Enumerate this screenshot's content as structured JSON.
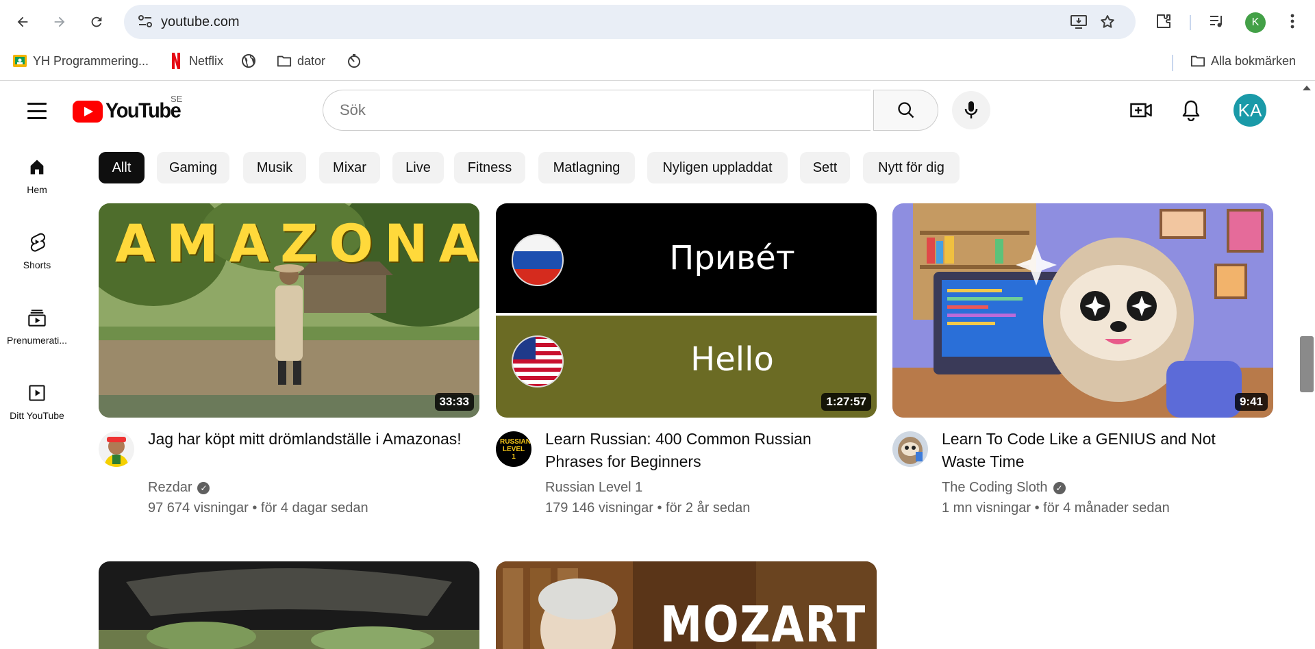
{
  "browser": {
    "url": "youtube.com",
    "bookmarks": [
      {
        "label": "YH Programmering...",
        "icon": "classroom-icon"
      },
      {
        "label": "Netflix",
        "icon": "netflix-icon"
      },
      {
        "label": "",
        "icon": "globe-icon"
      },
      {
        "label": "dator",
        "icon": "folder-icon"
      },
      {
        "label": "",
        "icon": "timer-icon"
      }
    ],
    "all_bookmarks_label": "Alla bokmärken",
    "profile_initial": "K"
  },
  "youtube": {
    "logo_text": "YouTube",
    "country_code": "SE",
    "search_placeholder": "Sök",
    "avatar_initials": "KA",
    "sidebar": [
      {
        "label": "Hem",
        "icon": "home-icon"
      },
      {
        "label": "Shorts",
        "icon": "shorts-icon"
      },
      {
        "label": "Prenumerati...",
        "icon": "subscriptions-icon"
      },
      {
        "label": "Ditt YouTube",
        "icon": "your-youtube-icon"
      }
    ],
    "chips": [
      "Allt",
      "Gaming",
      "Musik",
      "Mixar",
      "Live",
      "Fitness",
      "Matlagning",
      "Nyligen uppladdat",
      "Sett",
      "Nytt för dig"
    ],
    "active_chip": "Allt",
    "videos": [
      {
        "title": "Jag har köpt mitt drömlandställe i Amazonas!",
        "channel": "Rezdar",
        "verified": true,
        "meta": "97 674 visningar • för 4 dagar sedan",
        "duration": "33:33",
        "thumb_text": "AMAZONAS"
      },
      {
        "title": "Learn Russian: 400 Common Russian Phrases for Beginners",
        "channel": "Russian Level 1",
        "verified": false,
        "meta": "179 146 visningar • för 2 år sedan",
        "duration": "1:27:57",
        "thumb_text_top": "Приве́т",
        "thumb_text_bottom": "Hello",
        "avatar_text": "RUSSIAN LEVEL 1"
      },
      {
        "title": "Learn To Code Like a GENIUS and Not Waste Time",
        "channel": "The Coding Sloth",
        "verified": true,
        "meta": "1 mn visningar • för 4 månader sedan",
        "duration": "9:41"
      }
    ],
    "row2": [
      {
        "thumb_text": ""
      },
      {
        "thumb_text": "MOZART"
      }
    ]
  }
}
